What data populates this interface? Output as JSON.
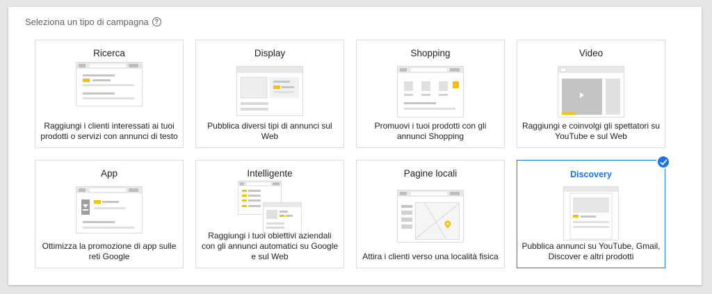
{
  "heading": "Seleziona un tipo di campagna",
  "help_icon": "?",
  "cards": [
    {
      "title": "Ricerca",
      "desc": "Raggiungi i clienti interessati ai tuoi prodotti o servizi con annunci di testo"
    },
    {
      "title": "Display",
      "desc": "Pubblica diversi tipi di annunci sul Web"
    },
    {
      "title": "Shopping",
      "desc": "Promuovi i tuoi prodotti con gli annunci Shopping"
    },
    {
      "title": "Video",
      "desc": "Raggiungi e coinvolgi gli spettatori su YouTube e sul Web"
    },
    {
      "title": "App",
      "desc": "Ottimizza la promozione di app sulle reti Google"
    },
    {
      "title": "Intelligente",
      "desc": "Raggiungi i tuoi obiettivi aziendali con gli annunci automatici su Google e sul Web"
    },
    {
      "title": "Pagine locali",
      "desc": "Attira i clienti verso una località fisica"
    },
    {
      "title": "Discovery",
      "desc": "Pubblica annunci su YouTube, Gmail, Discover e altri prodotti",
      "selected": true
    }
  ],
  "colors": {
    "accent": "#1a73e8",
    "highlight": "#fbbc04",
    "illustration_gray": "#e0e0e0"
  }
}
